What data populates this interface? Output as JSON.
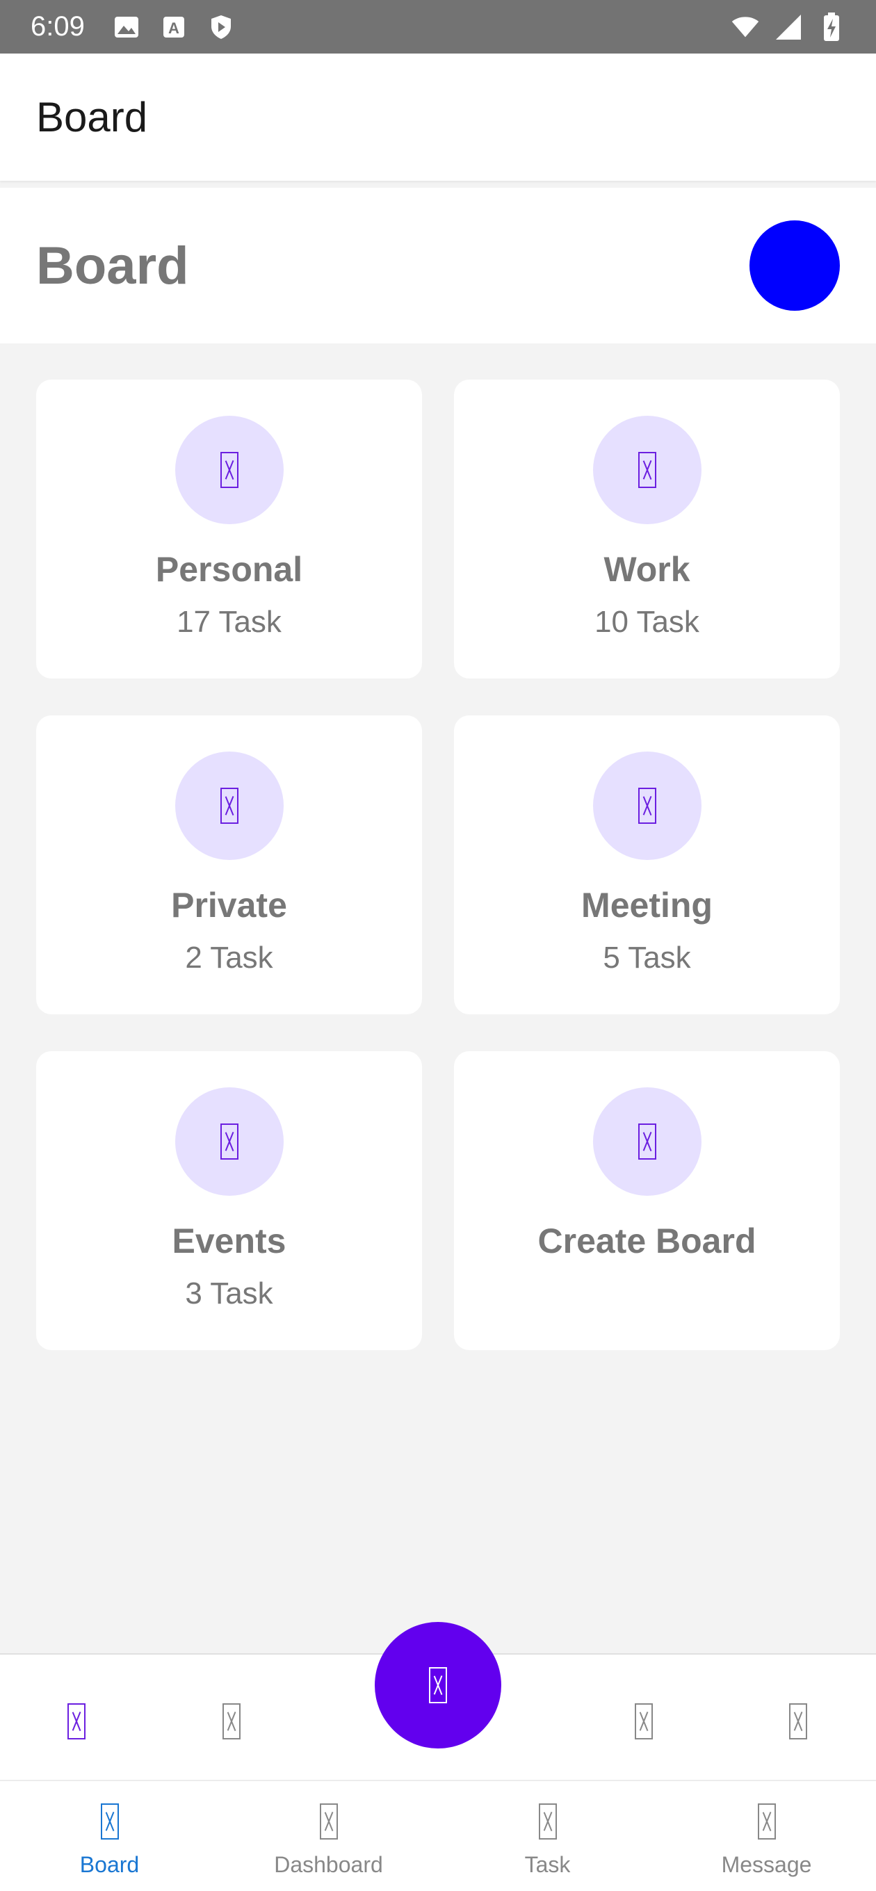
{
  "status_bar": {
    "time": "6:09",
    "left_icons": [
      "image-icon",
      "font-icon",
      "shield-icon"
    ],
    "right_icons": [
      "wifi-icon",
      "signal-icon",
      "battery-charging-icon"
    ]
  },
  "app_bar": {
    "title": "Board"
  },
  "header": {
    "title": "Board",
    "avatar_color": "#0000ff"
  },
  "boards": [
    {
      "title": "Personal",
      "count": "17 Task"
    },
    {
      "title": "Work",
      "count": "10 Task"
    },
    {
      "title": "Private",
      "count": "2 Task"
    },
    {
      "title": "Meeting",
      "count": "5 Task"
    },
    {
      "title": "Events",
      "count": "3 Task"
    },
    {
      "title": "Create Board",
      "count": ""
    }
  ],
  "bottom_bar": {
    "accent": "#6200ee",
    "fab_icon": "add-icon"
  },
  "tabs": [
    {
      "label": "Board",
      "active": true
    },
    {
      "label": "Dashboard",
      "active": false
    },
    {
      "label": "Task",
      "active": false
    },
    {
      "label": "Message",
      "active": false
    }
  ],
  "colors": {
    "accent": "#6200ee",
    "active_tab": "#1976d2",
    "icon_circle": "#e6e0ff"
  }
}
